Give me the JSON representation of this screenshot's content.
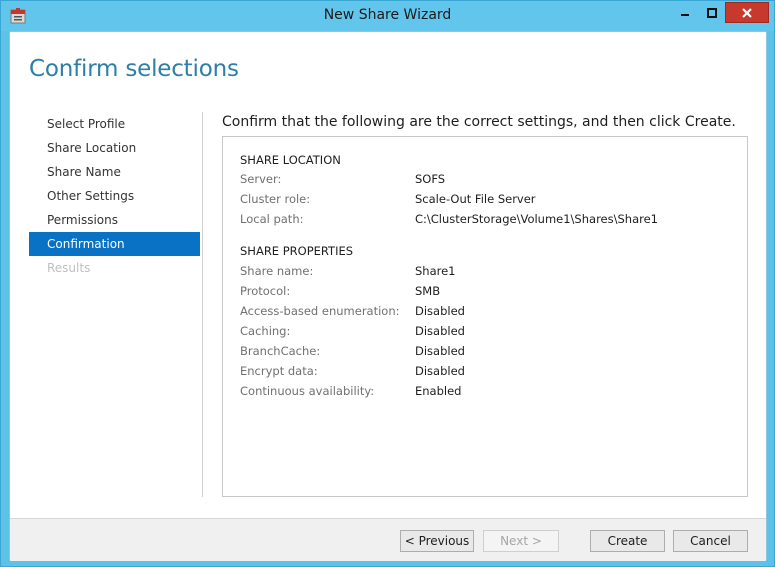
{
  "window": {
    "title": "New Share Wizard",
    "colors": {
      "chrome": "#62c6ec",
      "accent": "#0a72c4",
      "heading": "#2d7ea8",
      "close": "#c7382d"
    }
  },
  "page": {
    "heading": "Confirm selections",
    "instruction": "Confirm that the following are the correct settings, and then click Create."
  },
  "nav": {
    "items": [
      {
        "label": "Select Profile",
        "state": "normal"
      },
      {
        "label": "Share Location",
        "state": "normal"
      },
      {
        "label": "Share Name",
        "state": "normal"
      },
      {
        "label": "Other Settings",
        "state": "normal"
      },
      {
        "label": "Permissions",
        "state": "normal"
      },
      {
        "label": "Confirmation",
        "state": "active"
      },
      {
        "label": "Results",
        "state": "disabled"
      }
    ]
  },
  "share_location": {
    "title": "SHARE LOCATION",
    "rows": [
      {
        "label": "Server:",
        "value": "SOFS"
      },
      {
        "label": "Cluster role:",
        "value": "Scale-Out File Server"
      },
      {
        "label": "Local path:",
        "value": "C:\\ClusterStorage\\Volume1\\Shares\\Share1"
      }
    ]
  },
  "share_properties": {
    "title": "SHARE PROPERTIES",
    "rows": [
      {
        "label": "Share name:",
        "value": "Share1"
      },
      {
        "label": "Protocol:",
        "value": "SMB"
      },
      {
        "label": "Access-based enumeration:",
        "value": "Disabled"
      },
      {
        "label": "Caching:",
        "value": "Disabled"
      },
      {
        "label": "BranchCache:",
        "value": "Disabled"
      },
      {
        "label": "Encrypt data:",
        "value": "Disabled"
      },
      {
        "label": "Continuous availability:",
        "value": "Enabled"
      }
    ]
  },
  "buttons": {
    "previous": "< Previous",
    "next": "Next >",
    "create": "Create",
    "cancel": "Cancel"
  },
  "icons": {
    "app": "share-wizard-icon",
    "minimize": "minimize-icon",
    "maximize": "maximize-icon",
    "close": "close-icon"
  }
}
